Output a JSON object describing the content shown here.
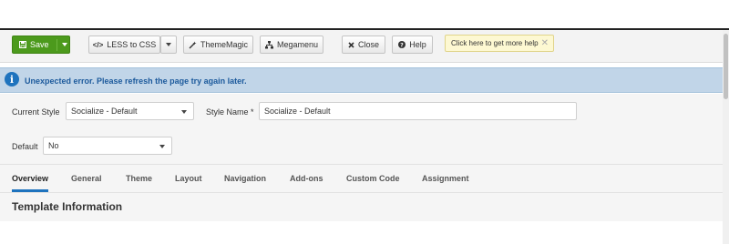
{
  "toolbar": {
    "save_label": "Save",
    "less_label": "LESS to CSS",
    "thememagic_label": "ThemeMagic",
    "megamenu_label": "Megamenu",
    "close_label": "Close",
    "help_label": "Help",
    "tip_text": "Click here to get more help",
    "tip_close": "✕",
    "icons": {
      "save": "save-icon",
      "less": "code-icon",
      "thememagic": "magic-wand-icon",
      "megamenu": "sitemap-icon",
      "close": "close-icon",
      "help": "question-icon"
    }
  },
  "alert": {
    "message": "Unexpected error. Please refresh the page try again later.",
    "icon_glyph": "i"
  },
  "form": {
    "current_style_label": "Current Style",
    "current_style_value": "Socialize - Default",
    "style_name_label": "Style Name *",
    "style_name_value": "Socialize - Default",
    "default_label": "Default",
    "default_value": "No"
  },
  "tabs": [
    {
      "label": "Overview"
    },
    {
      "label": "General"
    },
    {
      "label": "Theme"
    },
    {
      "label": "Layout"
    },
    {
      "label": "Navigation"
    },
    {
      "label": "Add-ons"
    },
    {
      "label": "Custom Code"
    },
    {
      "label": "Assignment"
    }
  ],
  "section_title": "Template Information",
  "colors": {
    "save_green": "#4c9a1c",
    "alert_bg": "#c1d5e8",
    "alert_text": "#1c5a9c",
    "tab_accent": "#1e73be"
  }
}
